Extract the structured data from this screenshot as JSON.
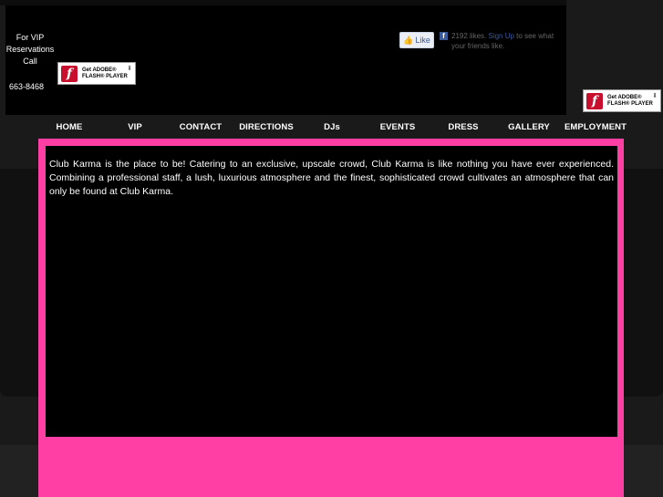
{
  "header": {
    "vip_line1": "For VIP",
    "vip_line2": "Reservations",
    "vip_line3": "Call",
    "phone": "663-8468"
  },
  "flash_badge": {
    "line1": "Get ADOBE®",
    "line2": "FLASH® PLAYER",
    "logo_letter": "f",
    "icon": "flash-player-icon"
  },
  "facebook": {
    "like_label": "Like",
    "fb_letter": "f",
    "likes_count": "2192 likes.",
    "signup": "Sign Up",
    "signup_suffix": " to see what your friends like."
  },
  "nav": {
    "items": [
      "HOME",
      "VIP",
      "CONTACT",
      "DIRECTIONS",
      "DJs",
      "EVENTS",
      "DRESS",
      "GALLERY",
      "EMPLOYMENT"
    ]
  },
  "main": {
    "text": "Club Karma is the place to be! Catering to an exclusive, upscale crowd, Club Karma is like nothing you have ever experienced. Combining a  professional staff, a lush, luxurious atmosphere and the finest, sophisticated crowd cultivates an atmosphere that can only be found at Club Karma."
  },
  "colors": {
    "accent_pink": "#ff3fa4",
    "background": "#000000",
    "facebook_blue": "#3b5998"
  }
}
